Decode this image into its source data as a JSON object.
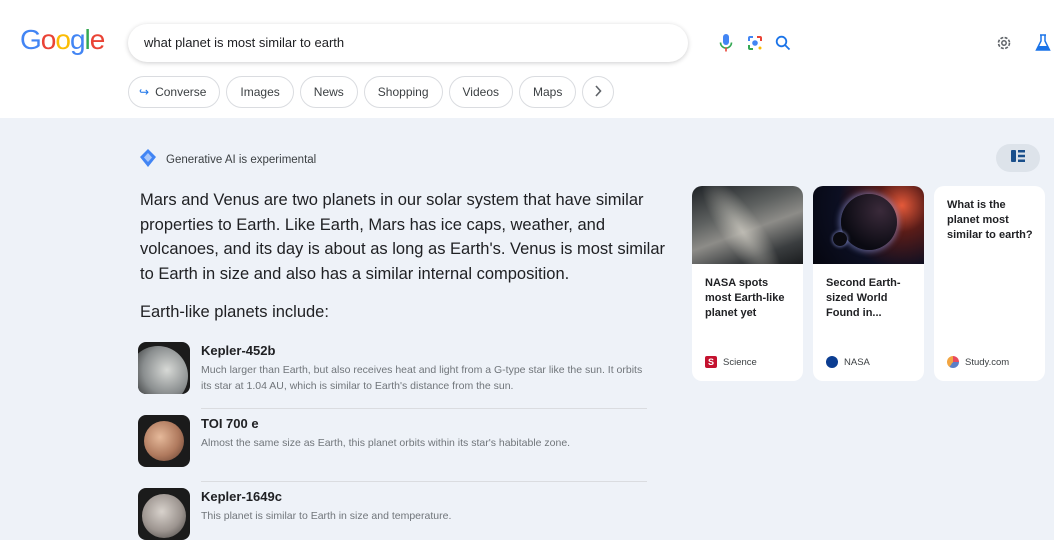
{
  "logo": {
    "letters": [
      "G",
      "o",
      "o",
      "g",
      "l",
      "e"
    ],
    "colors": [
      "#4285f4",
      "#ea4335",
      "#fbbc05",
      "#4285f4",
      "#34a853",
      "#ea4335"
    ]
  },
  "search": {
    "query": "what planet is most similar to earth"
  },
  "chips": {
    "converse": "Converse",
    "images": "Images",
    "news": "News",
    "shopping": "Shopping",
    "videos": "Videos",
    "maps": "Maps"
  },
  "ai": {
    "label": "Generative AI is experimental",
    "summary": "Mars and Venus are two planets in our solar system that have similar properties to Earth. Like Earth, Mars has ice caps, weather, and volcanoes, and its day is about as long as Earth's. Venus is most similar to Earth in size and also has a similar internal composition.",
    "subheading": "Earth-like planets include:",
    "planets": [
      {
        "name": "Kepler-452b",
        "desc": "Much larger than Earth, but also receives heat and light from a G-type star like the sun. It orbits its star at 1.04 AU, which is similar to Earth's distance from the sun."
      },
      {
        "name": "TOI 700 e",
        "desc": "Almost the same size as Earth, this planet orbits within its star's habitable zone."
      },
      {
        "name": "Kepler-1649c",
        "desc": "This planet is similar to Earth in size and temperature."
      }
    ]
  },
  "cards": [
    {
      "title": "NASA spots most Earth-like planet yet",
      "source": "Science",
      "source_color": "#c4122f"
    },
    {
      "title": "Second Earth-sized World Found in...",
      "source": "NASA",
      "source_color": "#0b3d91"
    },
    {
      "title": "What is the planet most similar to earth?",
      "source": "Study.com",
      "source_color": "#5b7fc7"
    }
  ],
  "colors": {
    "accent": "#1a73e8",
    "background": "#eef2f8"
  }
}
